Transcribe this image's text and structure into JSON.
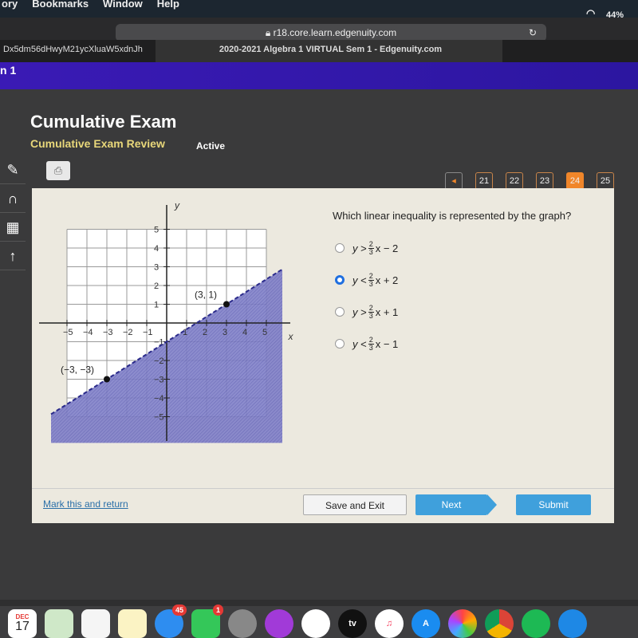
{
  "menubar": {
    "items": [
      "ory",
      "Bookmarks",
      "Window",
      "Help"
    ],
    "battery": "44%"
  },
  "browser": {
    "url": "r18.core.learn.edgenuity.com",
    "tabs": [
      "Dx5dm56dHwyM21ycXluaW5xdnJh",
      "2020-2021 Algebra 1 VIRTUAL Sem 1 - Edgenuity.com"
    ]
  },
  "banner": {
    "text": "n 1"
  },
  "header": {
    "title": "Cumulative Exam",
    "subtitle": "Cumulative Exam Review",
    "status": "Active"
  },
  "pagination": {
    "pages": [
      "21",
      "22",
      "23",
      "24",
      "25"
    ],
    "current": "24",
    "accent": "#f0862a"
  },
  "question": {
    "text": "Which linear inequality is represented by the graph?",
    "options": [
      {
        "y": "y",
        "op": ">",
        "num": "2",
        "den": "3",
        "rest": "x − 2",
        "selected": false
      },
      {
        "y": "y",
        "op": "<",
        "num": "2",
        "den": "3",
        "rest": "x + 2",
        "selected": true
      },
      {
        "y": "y",
        "op": ">",
        "num": "2",
        "den": "3",
        "rest": "x + 1",
        "selected": false
      },
      {
        "y": "y",
        "op": "<",
        "num": "2",
        "den": "3",
        "rest": "x − 1",
        "selected": false
      }
    ]
  },
  "graph": {
    "xlabel": "x",
    "ylabel": "y",
    "xrange": [
      -5,
      5
    ],
    "yrange": [
      -5,
      5
    ],
    "xticks": [
      "−5",
      "−4",
      "−3",
      "−2",
      "−1",
      "1",
      "2",
      "3",
      "4",
      "5"
    ],
    "yticks": [
      "5",
      "4",
      "3",
      "2",
      "1",
      "−1",
      "−2",
      "−3",
      "−4",
      "−5"
    ],
    "boundary": {
      "slope": 0.6667,
      "intercept": -1,
      "style": "dashed",
      "shade": "below"
    },
    "points": [
      {
        "x": 3,
        "y": 1,
        "label": "(3, 1)"
      },
      {
        "x": -3,
        "y": -3,
        "label": "(−3, −3)"
      }
    ],
    "shade_color": "#7f7fc8",
    "line_color": "#2a2a8a"
  },
  "footer": {
    "mark": "Mark this and return",
    "save": "Save and Exit",
    "next": "Next",
    "submit": "Submit"
  },
  "dock": {
    "calendar_month": "DEC",
    "calendar_day": "17",
    "messages_badge": "45",
    "facetime_badge": "1",
    "tv": "tv"
  }
}
